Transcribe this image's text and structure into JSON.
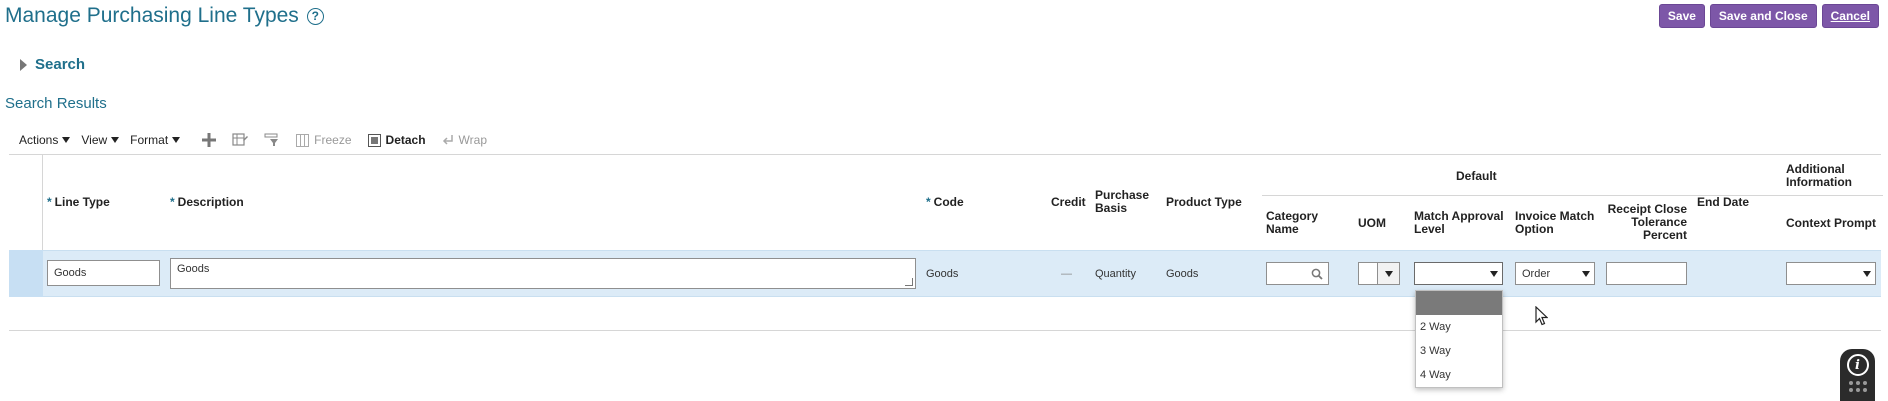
{
  "page": {
    "title": "Manage Purchasing Line Types",
    "help_glyph": "?"
  },
  "header_buttons": {
    "save": "Save",
    "save_and_close": "Save and Close",
    "cancel": "Cancel"
  },
  "search_section": {
    "label": "Search"
  },
  "results": {
    "title": "Search Results",
    "toolbar": {
      "actions": "Actions",
      "view": "View",
      "format": "Format",
      "freeze": "Freeze",
      "detach": "Detach",
      "wrap": "Wrap"
    },
    "columns": {
      "line_type": "Line Type",
      "description": "Description",
      "code": "Code",
      "credit": "Credit",
      "purchase_basis": "Purchase Basis",
      "product_type": "Product Type",
      "default_group": "Default",
      "category_name": "Category Name",
      "uom": "UOM",
      "match_approval_level": "Match Approval Level",
      "invoice_match_option": "Invoice Match Option",
      "receipt_close_tolerance_percent": "Receipt Close Tolerance Percent",
      "end_date": "End Date",
      "additional_info_group": "Additional Information",
      "context_prompt": "Context Prompt"
    },
    "row": {
      "line_type": "Goods",
      "description": "Goods",
      "code": "Goods",
      "credit": "—",
      "purchase_basis": "Quantity",
      "product_type": "Goods",
      "category_name": "",
      "uom": "",
      "match_approval_level": "",
      "invoice_match_option": "Order",
      "receipt_close_tolerance_percent": "",
      "end_date": "",
      "context_prompt": ""
    },
    "match_approval_dropdown": {
      "options": [
        "",
        "2 Way",
        "3 Way",
        "4 Way"
      ],
      "highlighted_index": 0
    }
  },
  "info_badge": {
    "glyph": "i"
  },
  "colors": {
    "accent_teal": "#1f6f8b",
    "button_purple": "#7d57a8",
    "row_selected": "#dcebf7"
  }
}
